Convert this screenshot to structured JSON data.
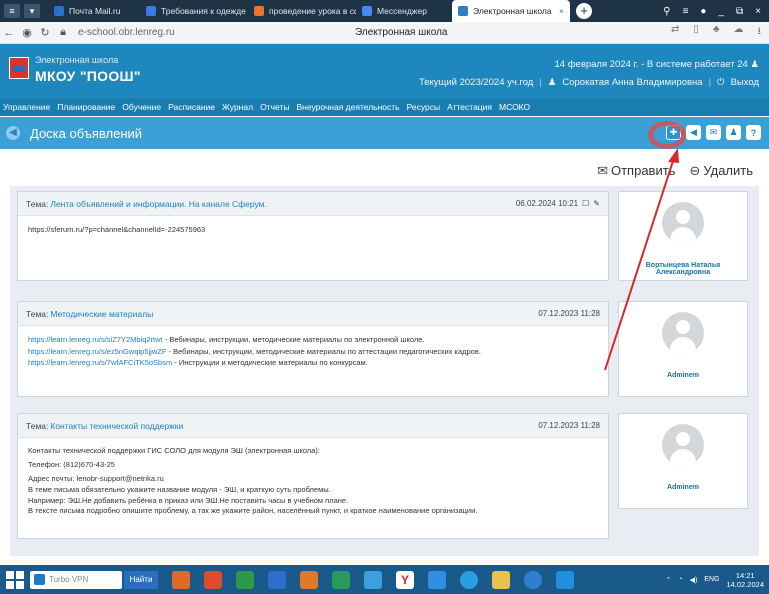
{
  "browser": {
    "tabs": [
      {
        "label": "Почта Mail.ru",
        "color": "#2b6fd1"
      },
      {
        "label": "Требования к одежде об",
        "color": "#3b7be8"
      },
      {
        "label": "проведение урока в сфер",
        "color": "#e8752c"
      },
      {
        "label": "Мессенджер",
        "color": "#4a8af0"
      },
      {
        "label": "Электронная школа",
        "color": "#2a7fc6",
        "active": true
      }
    ],
    "url": "e-school.obr.lenreg.ru",
    "page_title": "Электронная школа"
  },
  "header": {
    "subtitle": "Электронная школа",
    "school_name": "МКОУ \"ПООШ\"",
    "date_line": "14 февраля 2024 г. - В системе работает 24",
    "year": "Текущий 2023/2024 уч.год",
    "user": "Сорокатая Анна Владимировна",
    "logout": "Выход"
  },
  "menu": [
    "Управление",
    "Планирование",
    "Обучение",
    "Расписание",
    "Журнал",
    "Отчеты",
    "Внеурочная деятельность",
    "Ресурсы",
    "Аттестация",
    "МСОКО"
  ],
  "page": {
    "title": "Доска объявлений",
    "send": "Отправить",
    "delete": "Удалить"
  },
  "posts": [
    {
      "label": "Тема:",
      "topic": "Лента объявлений и информации. На канале Сферум.",
      "date": "06.02.2024 10:21",
      "lines": [
        {
          "text": "https://sferum.ru/?p=channel&channelId=-224575963",
          "link": false
        }
      ],
      "author": "Вортынцева Наталья Александровна"
    },
    {
      "label": "Тема:",
      "topic": "Методические материалы",
      "date": "07.12.2023 11:28",
      "lines": [
        {
          "link": "https://learn.lenreg.ru/s/siZ7Y2Mbiq2rtwt",
          "text": " - Вебинары, инструкции, методические материалы по электронной школе."
        },
        {
          "link": "https://learn.lenreg.ru/s/ez5nGwqip5jjwZF",
          "text": " - Вебинары, инструкции, методические материалы по аттестации педагогических кадров."
        },
        {
          "link": "https://learn.lenreg.ru/s/7wfAFCiTK5oSbsm",
          "text": " - Инструкции и методические материалы по конкурсам."
        }
      ],
      "author": "Adminem"
    },
    {
      "label": "Тема:",
      "topic": "Контакты технической поддержки",
      "date": "07.12.2023 11:28",
      "lines": [
        {
          "text": "Контакты технической поддержки ГИС СОЛО для модуля ЭШ (электронная школа):"
        },
        {
          "text": "Телефон: (812)670-43-25"
        },
        {
          "text": "Адрес почты: lenobr-support@netrika.ru"
        },
        {
          "text": "В теме письма обязательно укажите название модуля - ЭШ, и краткую суть проблемы."
        },
        {
          "text": "Например: ЭШ.Не добавить ребёнка в приказ или ЭШ.Не поставить часы в учебном плане."
        },
        {
          "text": "В тексте письма подробно опишите проблему, а так же укажите район, населённый пункт, и краткое наименование организации."
        }
      ],
      "author": "Adminem"
    }
  ],
  "taskbar": {
    "search_placeholder": "Turbo VPN",
    "find": "Найти",
    "lang": "ENG",
    "time": "14:21",
    "date": "14.02.2024"
  }
}
